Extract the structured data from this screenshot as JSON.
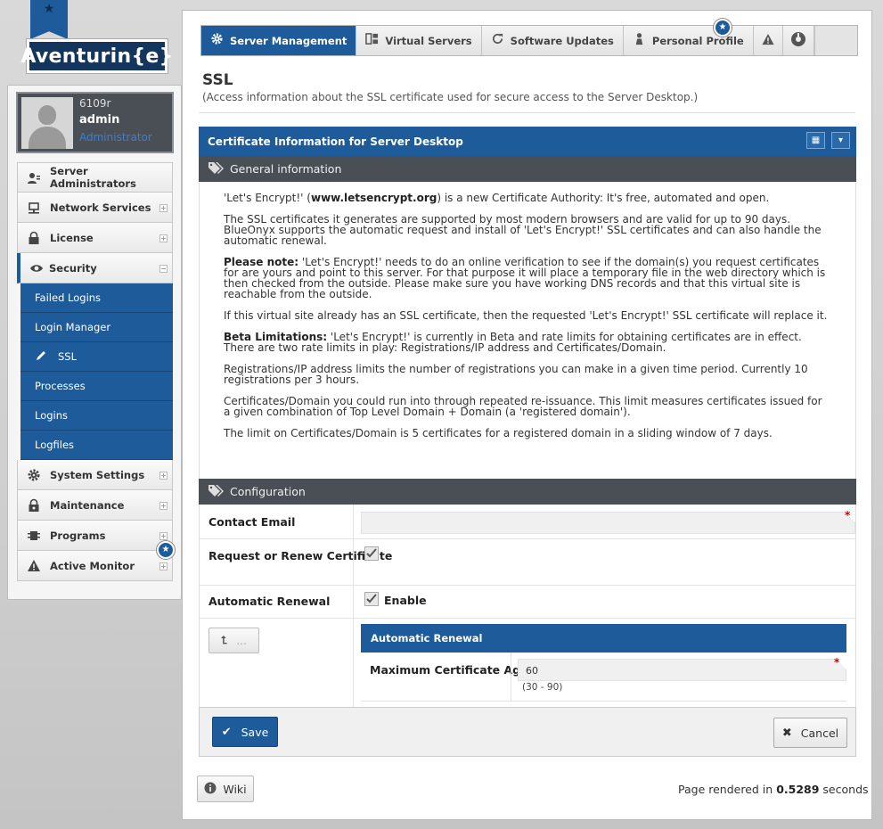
{
  "brand": {
    "logo_text": "Aventurin{e}"
  },
  "user": {
    "id": "6109r",
    "name": "admin",
    "role": "Administrator"
  },
  "sidebar": {
    "items": [
      {
        "label": "Server Administrators",
        "icon": "admin-users-icon",
        "expandable": false
      },
      {
        "label": "Network Services",
        "icon": "network-icon",
        "expandable": true
      },
      {
        "label": "License",
        "icon": "lock-icon",
        "expandable": true
      },
      {
        "label": "Security",
        "icon": "eye-icon",
        "expandable": true,
        "expanded": true
      },
      {
        "label": "System Settings",
        "icon": "gear-icon",
        "expandable": true
      },
      {
        "label": "Maintenance",
        "icon": "maintenance-lock-icon",
        "expandable": true
      },
      {
        "label": "Programs",
        "icon": "programs-icon",
        "expandable": true
      },
      {
        "label": "Active Monitor",
        "icon": "warning-icon",
        "expandable": true
      }
    ],
    "security_sub": [
      {
        "label": "Failed Logins"
      },
      {
        "label": "Login Manager"
      },
      {
        "label": "SSL",
        "current": true
      },
      {
        "label": "Processes"
      },
      {
        "label": "Logins"
      },
      {
        "label": "Logfiles"
      }
    ]
  },
  "topnav": {
    "tabs": [
      {
        "label": "Server Management",
        "icon": "gear-icon",
        "active": true
      },
      {
        "label": "Virtual Servers",
        "icon": "grid-icon"
      },
      {
        "label": "Software Updates",
        "icon": "refresh-icon"
      },
      {
        "label": "Personal Profile",
        "icon": "person-icon"
      }
    ]
  },
  "page": {
    "title": "SSL",
    "subtitle": "(Access information about the SSL certificate used for secure access to the Server Desktop.)"
  },
  "panel": {
    "title": "Certificate Information for Server Desktop"
  },
  "general": {
    "heading": "General information",
    "p1_pre": "'Let's Encrypt!' (",
    "p1_bold": "www.letsencrypt.org",
    "p1_post": ") is a new Certificate Authority: It's free, automated and open.",
    "p2": "The SSL certificates it generates are supported by most modern browsers and are valid for up to 90 days. BlueOnyx supports the automatic request and install of 'Let's Encrypt!' SSL certificates and can also handle the automatic renewal.",
    "p3_bold": "Please note:",
    "p3": " 'Let's Encrypt!' needs to do an online verification to see if the domain(s) you request certificates for are yours and point to this server. For that purpose it will place a temporary file in the web directory which is then checked from the outside. Please make sure you have working DNS records and that this virtual site is reachable from the outside.",
    "p4": "If this virtual site already has an SSL certificate, then the requested 'Let's Encrypt!' SSL certificate will replace it.",
    "p5_bold": "Beta Limitations:",
    "p5": " 'Let's Encrypt!' is currently in Beta and rate limits for obtaining certificates are in effect. There are two rate limits in play: Registrations/IP address and Certificates/Domain.",
    "p6": "Registrations/IP address limits the number of registrations you can make in a given time period. Currently 10 registrations per 3 hours.",
    "p7": "Certificates/Domain you could run into through repeated re-issuance. This limit measures certificates issued for a given combination of Top Level Domain + Domain (a 'registered domain').",
    "p8": "The limit on Certificates/Domain is 5 certificates for a registered domain in a sliding window of 7 days."
  },
  "config": {
    "heading": "Configuration",
    "contact_email_label": "Contact Email",
    "contact_email_value": "",
    "request_label": "Request or Renew Certificate",
    "request_checked": true,
    "auto_renew_label": "Automatic Renewal",
    "auto_renew_checkbox_label": "Enable",
    "auto_renew_checked": true,
    "back_button_label": "...",
    "sub_panel_title": "Automatic Renewal",
    "max_age_label": "Maximum Certificate Age",
    "max_age_value": "60",
    "max_age_range": "(30 - 90)"
  },
  "actions": {
    "save": "Save",
    "cancel": "Cancel",
    "wiki": "Wiki"
  },
  "footer": {
    "render_prefix": "Page rendered in",
    "render_time": "0.5289",
    "render_suffix": "seconds"
  },
  "colors": {
    "primary": "#1d5b9a",
    "dark_header": "#4a4f55",
    "required": "#cc0000"
  }
}
